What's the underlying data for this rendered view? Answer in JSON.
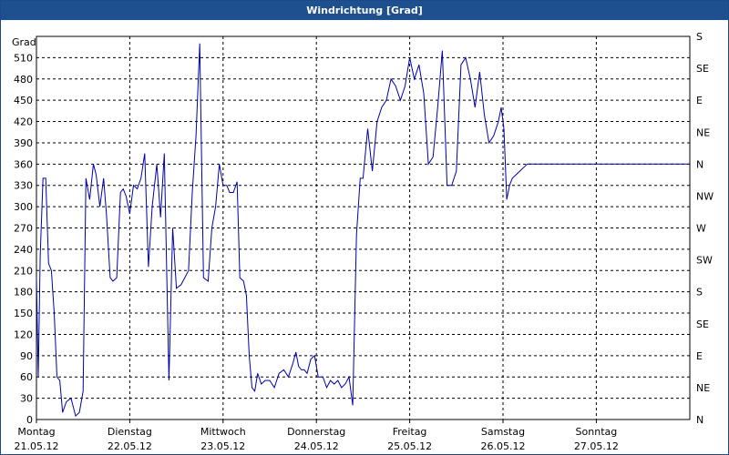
{
  "window": {
    "title": "Windrichtung [Grad]"
  },
  "chart_data": {
    "type": "line",
    "title": "Windrichtung [Grad]",
    "ylabel": "Grad",
    "ylim": [
      0,
      540
    ],
    "yticks": [
      0,
      30,
      60,
      90,
      120,
      150,
      180,
      210,
      240,
      270,
      300,
      330,
      360,
      390,
      420,
      450,
      480,
      510
    ],
    "y2_ticks": [
      {
        "value": 0,
        "label": "N"
      },
      {
        "value": 45,
        "label": "NE"
      },
      {
        "value": 90,
        "label": "E"
      },
      {
        "value": 135,
        "label": "SE"
      },
      {
        "value": 180,
        "label": "S"
      },
      {
        "value": 225,
        "label": "SW"
      },
      {
        "value": 270,
        "label": "W"
      },
      {
        "value": 315,
        "label": "NW"
      },
      {
        "value": 360,
        "label": "N"
      },
      {
        "value": 405,
        "label": "NE"
      },
      {
        "value": 450,
        "label": "E"
      },
      {
        "value": 495,
        "label": "SE"
      },
      {
        "value": 540,
        "label": "S"
      }
    ],
    "xlim": [
      0,
      7
    ],
    "xticks": [
      {
        "value": 0,
        "day": "Montag",
        "date": "21.05.12"
      },
      {
        "value": 1,
        "day": "Dienstag",
        "date": "22.05.12"
      },
      {
        "value": 2,
        "day": "Mittwoch",
        "date": "23.05.12"
      },
      {
        "value": 3,
        "day": "Donnerstag",
        "date": "24.05.12"
      },
      {
        "value": 4,
        "day": "Freitag",
        "date": "25.05.12"
      },
      {
        "value": 5,
        "day": "Samstag",
        "date": "26.05.12"
      },
      {
        "value": 6,
        "day": "Sonntag",
        "date": "27.05.12"
      }
    ],
    "grid": true,
    "series": [
      {
        "color": "#0000aa",
        "x": [
          0,
          0.02,
          0.04,
          0.07,
          0.1,
          0.13,
          0.16,
          0.19,
          0.22,
          0.25,
          0.28,
          0.32,
          0.37,
          0.42,
          0.46,
          0.5,
          0.53,
          0.57,
          0.61,
          0.64,
          0.68,
          0.72,
          0.75,
          0.79,
          0.82,
          0.86,
          0.9,
          0.93,
          0.96,
          1.0,
          1.04,
          1.08,
          1.12,
          1.16,
          1.2,
          1.24,
          1.29,
          1.33,
          1.37,
          1.42,
          1.46,
          1.5,
          1.55,
          1.59,
          1.63,
          1.67,
          1.71,
          1.75,
          1.79,
          1.84,
          1.88,
          1.92,
          1.96,
          2.0,
          2.04,
          2.07,
          2.11,
          2.15,
          2.18,
          2.22,
          2.25,
          2.28,
          2.31,
          2.34,
          2.37,
          2.41,
          2.45,
          2.5,
          2.55,
          2.6,
          2.65,
          2.7,
          2.75,
          2.78,
          2.81,
          2.84,
          2.87,
          2.9,
          2.94,
          2.98,
          3.02,
          3.07,
          3.11,
          3.15,
          3.19,
          3.23,
          3.27,
          3.31,
          3.35,
          3.39,
          3.43,
          3.47,
          3.5,
          3.55,
          3.6,
          3.65,
          3.7,
          3.75,
          3.8,
          3.85,
          3.9,
          3.95,
          4.0,
          4.05,
          4.1,
          4.15,
          4.2,
          4.25,
          4.3,
          4.35,
          4.4,
          4.45,
          4.5,
          4.55,
          4.6,
          4.65,
          4.7,
          4.75,
          4.8,
          4.85,
          4.9,
          4.95,
          4.98,
          5.01,
          5.04,
          5.07,
          5.1,
          5.14,
          5.18,
          5.22,
          5.26,
          5.3,
          5.34,
          5.38,
          5.42,
          5.46,
          5.5,
          5.54,
          5.58,
          5.62,
          5.66,
          5.7,
          5.74,
          5.78,
          5.82,
          5.86,
          5.9,
          5.94,
          5.97,
          6.0,
          6.04,
          6.08,
          6.12,
          6.16,
          6.2,
          6.24,
          6.28,
          6.32,
          6.36,
          6.4,
          6.44,
          6.48,
          6.52,
          6.56,
          6.6,
          6.64,
          6.68,
          6.72,
          6.76,
          6.8,
          6.84,
          6.88,
          6.92,
          6.96,
          7.0
        ],
        "y": [
          200,
          60,
          230,
          340,
          340,
          220,
          210,
          150,
          60,
          55,
          10,
          25,
          30,
          5,
          10,
          40,
          340,
          310,
          360,
          345,
          300,
          340,
          290,
          200,
          195,
          200,
          320,
          325,
          315,
          290,
          330,
          325,
          340,
          375,
          215,
          300,
          360,
          285,
          375,
          55,
          270,
          185,
          190,
          200,
          210,
          320,
          400,
          530,
          200,
          195,
          270,
          300,
          360,
          330,
          330,
          320,
          320,
          335,
          200,
          195,
          175,
          90,
          45,
          40,
          65,
          50,
          55,
          55,
          45,
          65,
          70,
          60,
          80,
          95,
          75,
          70,
          70,
          65,
          85,
          90,
          60,
          60,
          45,
          55,
          50,
          55,
          45,
          50,
          60,
          20,
          260,
          340,
          340,
          410,
          350,
          420,
          440,
          450,
          480,
          470,
          450,
          470,
          510,
          480,
          500,
          460,
          360,
          370,
          440,
          520,
          330,
          330,
          350,
          500,
          510,
          480,
          440,
          490,
          430,
          390,
          400,
          420,
          440,
          410,
          310,
          330,
          340,
          345,
          350,
          355,
          360,
          360,
          360,
          360,
          360,
          360,
          360,
          360,
          360,
          360,
          360,
          360,
          360,
          360,
          360,
          360,
          360,
          360,
          360,
          360,
          360,
          360,
          360,
          360,
          360,
          360,
          360,
          360,
          360,
          360,
          360,
          360,
          360,
          360,
          360,
          360,
          360,
          360,
          360,
          360,
          360,
          360,
          360,
          360,
          360
        ]
      }
    ]
  }
}
